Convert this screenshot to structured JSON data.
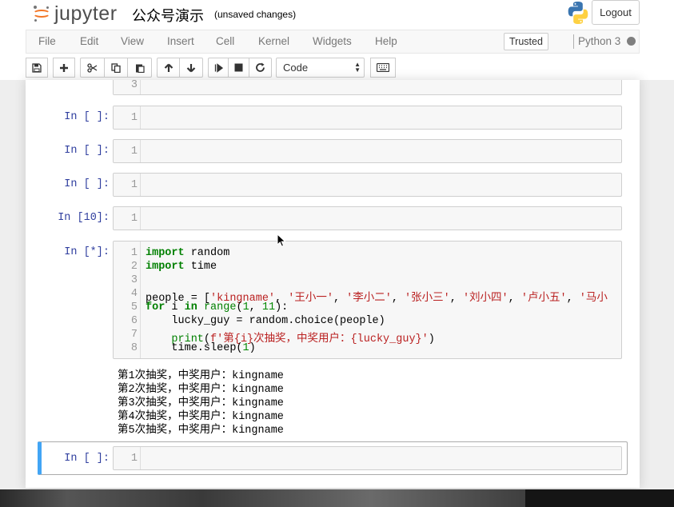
{
  "header": {
    "logo_text": "jupyter",
    "notebook_title": "公众号演示",
    "save_status": "(unsaved changes)",
    "logout_label": "Logout"
  },
  "menubar": {
    "items": [
      "File",
      "Edit",
      "View",
      "Insert",
      "Cell",
      "Kernel",
      "Widgets",
      "Help"
    ],
    "trusted_label": "Trusted",
    "kernel_name": "Python 3"
  },
  "toolbar": {
    "buttons": [
      "save-icon",
      "plus-icon",
      "cut-icon",
      "copy-icon",
      "paste-icon",
      "arrow-up-icon",
      "arrow-down-icon",
      "run-step-icon",
      "stop-icon",
      "restart-icon",
      "keyboard-icon"
    ],
    "cell_type": "Code"
  },
  "cells": {
    "partial": {
      "line_numbers": [
        "3"
      ]
    },
    "c1": {
      "prompt": "In [ ]:",
      "line_numbers": [
        "1"
      ]
    },
    "c2": {
      "prompt": "In [ ]:",
      "line_numbers": [
        "1"
      ]
    },
    "c3": {
      "prompt": "In [ ]:",
      "line_numbers": [
        "1"
      ]
    },
    "c4": {
      "prompt": "In [10]:",
      "line_numbers": [
        "1"
      ]
    },
    "c5": {
      "prompt": "In [*]:",
      "line_numbers": [
        "1",
        "2",
        "3",
        "4",
        "5",
        "6",
        "7",
        "8"
      ],
      "code": {
        "l1_kw": "import",
        "l1_rest": " random",
        "l2_kw": "import",
        "l2_rest": " time",
        "l4_a": "people = [",
        "l4_s1": "'kingname'",
        "l4_c1": ", ",
        "l4_s2": "'王小一'",
        "l4_c2": ", ",
        "l4_s3": "'李小二'",
        "l4_c3": ", ",
        "l4_s4": "'张小三'",
        "l4_c4": ", ",
        "l4_s5": "'刘小四'",
        "l4_c5": ", ",
        "l4_s6": "'卢小五'",
        "l4_c6": ", ",
        "l4_s7": "'马小",
        "l5_kw1": "for",
        "l5_a": " i ",
        "l5_kw2": "in",
        "l5_sp": " ",
        "l5_bi": "range",
        "l5_b": "(",
        "l5_n1": "1",
        "l5_c": ", ",
        "l5_n2": "11",
        "l5_e": "):",
        "l6": "    lucky_guy = random.choice(people)",
        "l7_ind": "    ",
        "l7_bi": "print",
        "l7_p": "(",
        "l7_s": "f'第{i}次抽奖，中奖用户：{lucky_guy}'",
        "l7_e": ")",
        "l8_a": "    time.sleep(",
        "l8_n": "1",
        "l8_e": ")"
      },
      "outputs": [
        "第1次抽奖，中奖用户：kingname",
        "第2次抽奖，中奖用户：kingname",
        "第3次抽奖，中奖用户：kingname",
        "第4次抽奖，中奖用户：kingname",
        "第5次抽奖，中奖用户：kingname"
      ]
    },
    "c6": {
      "prompt": "In [ ]:",
      "line_numbers": [
        "1"
      ]
    }
  },
  "colors": {
    "prompt": "#303f9f",
    "keyword": "#008000",
    "string": "#ba2121",
    "selected_border": "#42a5f5",
    "jupyter_orange": "#f37626"
  }
}
